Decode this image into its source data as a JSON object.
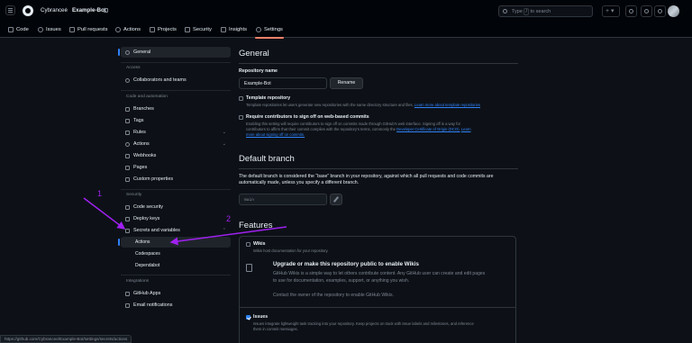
{
  "topbar": {
    "owner": "Cybrancee",
    "separator": "/",
    "repo": "Example-Bot",
    "search_prefix": "Type",
    "search_key": "/",
    "search_suffix": "to search",
    "cmd_label": ">_",
    "plus_label": "+ ▾"
  },
  "nav": {
    "tabs": [
      {
        "label": "Code"
      },
      {
        "label": "Issues"
      },
      {
        "label": "Pull requests"
      },
      {
        "label": "Actions"
      },
      {
        "label": "Projects"
      },
      {
        "label": "Security"
      },
      {
        "label": "Insights"
      },
      {
        "label": "Settings"
      }
    ]
  },
  "sidebar": {
    "general": "General",
    "access_heading": "Access",
    "collaborators": "Collaborators and teams",
    "code_heading": "Code and automation",
    "branches": "Branches",
    "tags": "Tags",
    "rules": "Rules",
    "actions": "Actions",
    "webhooks": "Webhooks",
    "pages": "Pages",
    "custom_properties": "Custom properties",
    "security_heading": "Security",
    "code_security": "Code security",
    "deploy_keys": "Deploy keys",
    "secrets_variables": "Secrets and variables",
    "sub_actions": "Actions",
    "sub_codespaces": "Codespaces",
    "sub_dependabot": "Dependabot",
    "integrations_heading": "Integrations",
    "github_apps": "GitHub Apps",
    "email_notifications": "Email notifications"
  },
  "main": {
    "title": "General",
    "repo_name_label": "Repository name",
    "repo_name_value": "Example-Bot",
    "rename_label": "Rename",
    "template": {
      "label": "Template repository",
      "desc": "Template repositories let users generate new repositories with the same directory structure and files.",
      "link": "Learn more about template repositories"
    },
    "signoff": {
      "label": "Require contributors to sign off on web-based commits",
      "desc_line1": "Enabling this setting will require contributors to sign off on commits made through GitHub's web interface. Signing off is a way for",
      "desc_line2_a": "contributors to affirm that their commit complies with the repository's terms, commonly the",
      "desc_line2_link": "Developer Certificate of Origin (DCO).",
      "desc_line2_link2": "Learn",
      "desc_line3_link": "more about signing off on commits."
    },
    "default_branch_title": "Default branch",
    "default_branch_desc_1": "The default branch is considered the “base” branch in your repository, against which all pull requests and code commits are",
    "default_branch_desc_2": "automatically made, unless you specify a different branch.",
    "default_branch_value": "main",
    "features_title": "Features",
    "wikis": {
      "label": "Wikis",
      "desc": "Wikis host documentation for your repository.",
      "upgrade_title": "Upgrade or make this repository public to enable Wikis",
      "upgrade_desc_1": "GitHub Wikis is a simple way to let others contribute content. Any GitHub user can create and edit pages",
      "upgrade_desc_2": "to use for documentation, examples, support, or anything you wish.",
      "contact": "Contact the owner of the repository to enable GitHub Wikis."
    },
    "issues": {
      "label": "Issues",
      "desc_1": "Issues integrate lightweight task tracking into your repository. Keep projects on track with issue labels and milestones, and reference",
      "desc_2": "them in commit messages."
    }
  },
  "status_url": "https://github.com/Cybrancee/Example-Bot/settings/secrets/actions",
  "annotations": {
    "step1": "1",
    "step2": "2",
    "color": "#a020f0"
  }
}
